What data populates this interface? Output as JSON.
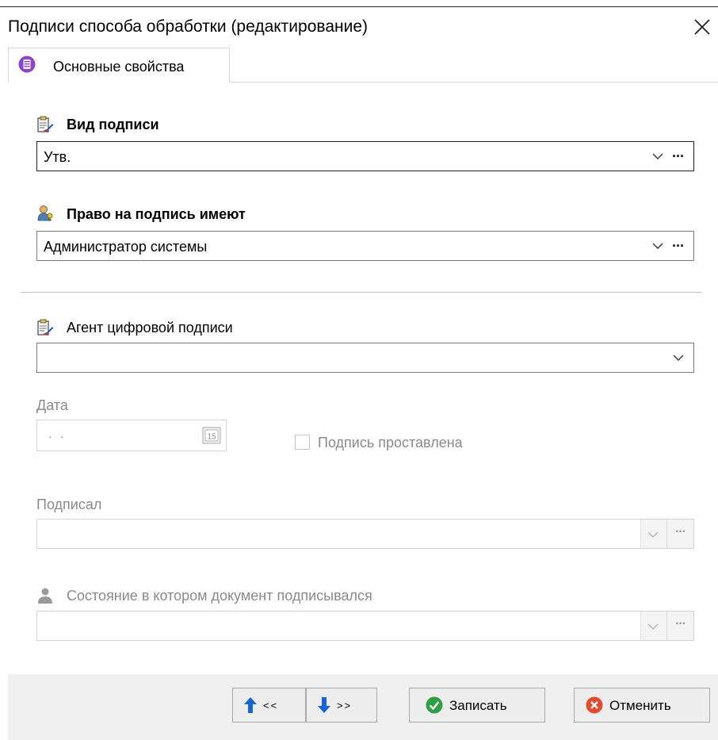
{
  "window": {
    "title": "Подписи способа обработки (редактирование)",
    "close_icon": "close-icon"
  },
  "tabs": [
    {
      "label": "Основные свойства",
      "icon": "database-icon",
      "active": true
    }
  ],
  "form": {
    "signature_type": {
      "label": "Вид подписи",
      "value": "Утв.",
      "icon": "signature-doc-icon"
    },
    "signing_right": {
      "label": "Право на подпись имеют",
      "value": "Администратор системы",
      "icon": "user-key-icon"
    },
    "digital_agent": {
      "label": "Агент цифровой подписи",
      "value": "",
      "icon": "signature-doc-icon"
    },
    "date": {
      "label": "Дата",
      "value": ". .",
      "calendar_label": "15"
    },
    "signed_checkbox": {
      "label": "Подпись проставлена",
      "checked": false
    },
    "signed_by": {
      "label": "Подписал",
      "value": ""
    },
    "doc_state": {
      "label": "Состояние в котором документ подписывался",
      "value": "",
      "icon": "person-icon"
    }
  },
  "footer": {
    "prev_label": "<<",
    "next_label": ">>",
    "save_label": "Записать",
    "cancel_label": "Отменить"
  },
  "colors": {
    "accent_purple": "#8e44c9",
    "save_green": "#2ea043",
    "cancel_red": "#e34a2f",
    "arrow_blue": "#1565d8"
  }
}
